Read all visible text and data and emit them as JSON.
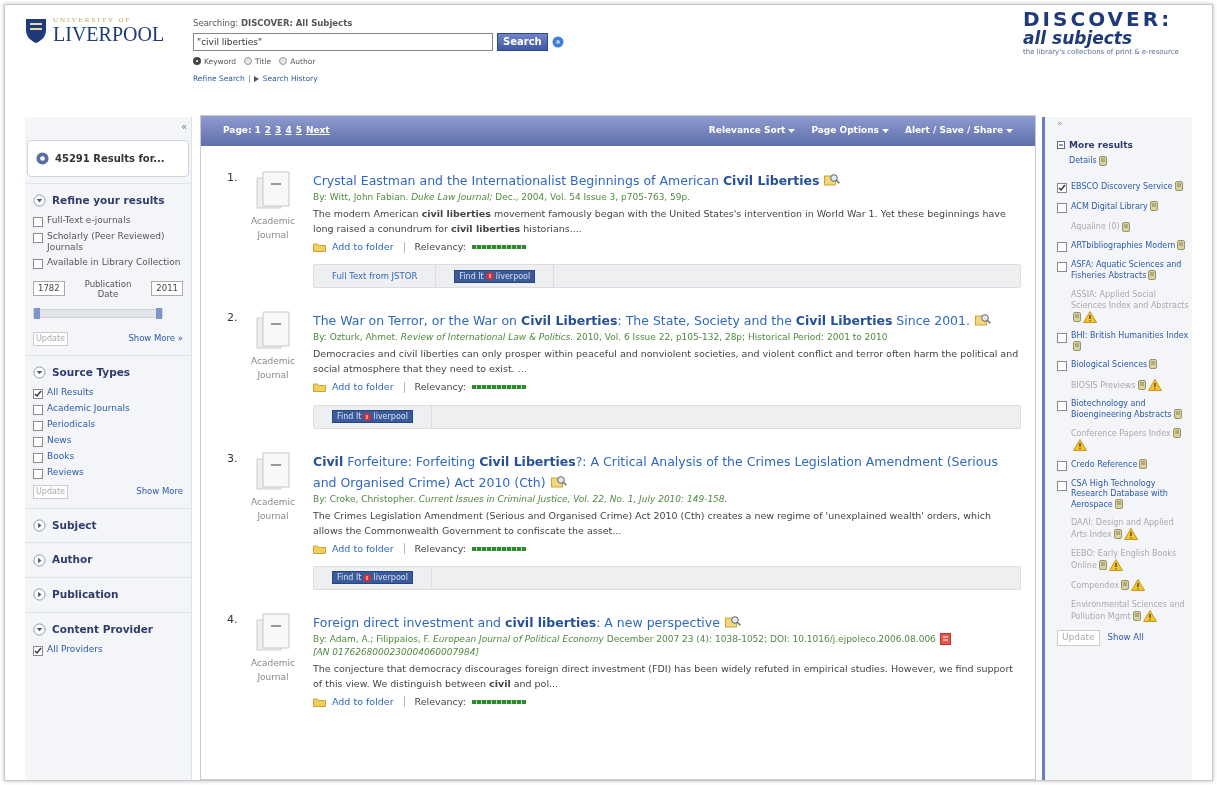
{
  "header": {
    "logo_small": "UNIVERSITY OF",
    "logo_big": "LIVERPOOL",
    "searching": "Searching: **DISCOVER: All Subjects**",
    "query": "\"civil liberties\"",
    "search_button": "Search",
    "modes": [
      {
        "label": "Keyword",
        "selected": true
      },
      {
        "label": "Title",
        "selected": false
      },
      {
        "label": "Author",
        "selected": false
      }
    ],
    "links": [
      "Refine Search",
      "Search History"
    ],
    "brand": "DISCOVER:",
    "brand_sub": "all subjects",
    "brand_tag": "the library's collections of print & e-resource"
  },
  "left": {
    "collapse": "«",
    "results_count": "45291 Results for...",
    "refine": {
      "title": "Refine your results",
      "expanded": true,
      "options": [
        {
          "label": "Full-Text e-journals",
          "checked": false
        },
        {
          "label": "Scholarly (Peer Reviewed) Journals",
          "checked": false
        },
        {
          "label": "Available in Library Collection",
          "checked": false
        }
      ],
      "date_from": "1782",
      "date_label": "Publication Date",
      "date_to": "2011",
      "range_low": {
        "level": 0
      },
      "range_high": {
        "level": 1
      },
      "update": "Update",
      "show_more": "Show More »"
    },
    "source": {
      "title": "Source Types",
      "expanded": true,
      "options": [
        {
          "label": "All Results",
          "checked": true
        },
        {
          "label": "Academic Journals",
          "checked": false
        },
        {
          "label": "Periodicals",
          "checked": false
        },
        {
          "label": "News",
          "checked": false
        },
        {
          "label": "Books",
          "checked": false
        },
        {
          "label": "Reviews",
          "checked": false
        }
      ],
      "update": "Update",
      "show_more": "Show More"
    },
    "sections": [
      {
        "title": "Subject",
        "expanded": false
      },
      {
        "title": "Author",
        "expanded": false
      },
      {
        "title": "Publication",
        "expanded": false
      }
    ],
    "provider": {
      "title": "Content Provider",
      "expanded": true,
      "options": [
        {
          "label": "All Providers",
          "checked": true
        }
      ]
    }
  },
  "toolbar": {
    "page_label": "Page:",
    "pages": [
      {
        "label": "1",
        "selected": true
      },
      {
        "label": "2",
        "selected": false
      },
      {
        "label": "3",
        "selected": false
      },
      {
        "label": "4",
        "selected": false
      },
      {
        "label": "5",
        "selected": false
      }
    ],
    "next": "Next",
    "menus": [
      "Relevance Sort",
      "Page Options",
      "Alert / Save / Share"
    ]
  },
  "results": [
    {
      "number": "1.",
      "type": "Academic Journal",
      "title": "Crystal Eastman and the Internationalist Beginnings of American **Civil Liberties**",
      "meta": "By: Witt, John Fabian. *Duke Law Journal;* Dec., 2004, Vol. 54 Issue 3, p705-763, 59p.",
      "abstract": "The modern American **civil liberties** movement famously began with the United States's intervention in World War 1. Yet these beginnings have long raised a conundrum for **civil liberties** historians....",
      "add": "Add to folder",
      "relevancy_label": "Relevancy:",
      "pdf": false,
      "links": [
        {
          "kind": "text",
          "label": "Full Text from JSTOR"
        },
        {
          "kind": "findit",
          "label": "Find It",
          "label2": "liverpool"
        }
      ]
    },
    {
      "number": "2.",
      "type": "Academic Journal",
      "title": "The War on Terror, or the War on **Civil Liberties**: The State, Society and the **Civil Liberties** Since 2001.",
      "meta": "By: Ozturk, Ahmet. *Review of International Law & Politics.* 2010, Vol. 6 Issue 22, p105-132, 28p; Historical Period: 2001 to 2010",
      "abstract": "Democracies and civil liberties can only prosper within peaceful and nonviolent societies, and violent conflict and terror often harm the political and social atmosphere that they need to exist. ...",
      "add": "Add to folder",
      "relevancy_label": "Relevancy:",
      "pdf": false,
      "links": [
        {
          "kind": "findit",
          "label": "Find It",
          "label2": "liverpool"
        }
      ]
    },
    {
      "number": "3.",
      "type": "Academic Journal",
      "title": "**Civil** Forfeiture: Forfeiting **Civil Liberties**?: A Critical Analysis of the Crimes Legislation Amendment (Serious and Organised Crime) Act 2010 (Cth)",
      "meta": "By: Croke, Christopher. *Current Issues in Criminal Justice, Vol. 22, No. 1, July 2010: 149-158.*",
      "abstract": "The Crimes Legislation Amendment (Serious and Organised Crime) Act 2010 (Cth) creates a new regime of 'unexplained wealth' orders, which allows the Commonwealth Government to confiscate the asset...",
      "add": "Add to folder",
      "relevancy_label": "Relevancy:",
      "pdf": false,
      "links": [
        {
          "kind": "findit",
          "label": "Find It",
          "label2": "liverpool"
        }
      ]
    },
    {
      "number": "4.",
      "type": "Academic Journal",
      "title": "Foreign direct investment and **civil liberties**: A new perspective",
      "meta": "By: Adam, A.; Filippaios, F. *European Journal of Political Economy* December 2007 23 (4): 1038-1052; DOI: 10.1016/j.ejpoleco.2006.08.006",
      "meta2": "[AN 0176268000230004060007984]",
      "abstract": "The conjecture that democracy discourages foreign direct investment (FDI) has been widely refuted in empirical studies. However, we find support of this view. We distinguish between **civil** and pol...",
      "add": "Add to folder",
      "relevancy_label": "Relevancy:",
      "pdf": true
    }
  ],
  "right": {
    "collapse": "»",
    "title": "More results",
    "details": "Details",
    "items": [
      {
        "kind": "check",
        "label": "EBSCO Discovery Service",
        "checked": true,
        "warning": false
      },
      {
        "kind": "check",
        "label": "ACM Digital Library",
        "checked": false,
        "warning": false
      },
      {
        "kind": "note",
        "label": "Aqualine (0)",
        "warning": false
      },
      {
        "kind": "check",
        "label": "ARTbibliographies Modern",
        "checked": false,
        "warning": false
      },
      {
        "kind": "check",
        "label": "ASFA: Aquatic Sciences and Fisheries Abstracts",
        "checked": false,
        "warning": false
      },
      {
        "kind": "note",
        "label": "ASSIA: Applied Social Sciences Index and Abstracts",
        "warning": true
      },
      {
        "kind": "check",
        "label": "BHI: British Humanities Index",
        "checked": false,
        "warning": false
      },
      {
        "kind": "check",
        "label": "Biological Sciences",
        "checked": false,
        "warning": false
      },
      {
        "kind": "note",
        "label": "BIOSIS Previews",
        "warning": true
      },
      {
        "kind": "check",
        "label": "Biotechnology and Bioengineering Abstracts",
        "checked": false,
        "warning": false
      },
      {
        "kind": "note",
        "label": "Conference Papers Index",
        "warning": true
      },
      {
        "kind": "check",
        "label": "Credo Reference",
        "checked": false,
        "warning": false
      },
      {
        "kind": "check",
        "label": "CSA High Technology Research Database with Aerospace",
        "checked": false,
        "warning": false
      },
      {
        "kind": "note",
        "label": "DAAI: Design and Applied Arts Index",
        "warning": true
      },
      {
        "kind": "note",
        "label": "EEBO: Early English Books Online",
        "warning": true
      },
      {
        "kind": "note",
        "label": "Compendex",
        "warning": true
      },
      {
        "kind": "note",
        "label": "Environmental Sciences and Pollution Mgmt",
        "warning": true
      }
    ],
    "update": "Update",
    "show_all": "Show All"
  }
}
